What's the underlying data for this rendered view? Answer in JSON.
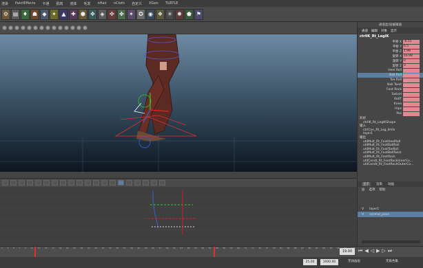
{
  "menus": [
    "渲染",
    "PaintEffects",
    "卡通",
    "肌肉",
    "流体",
    "毛发",
    "nHair",
    "nCloth",
    "自定义",
    "XGen",
    "TURTLE"
  ],
  "channel_box": {
    "header_tabs": [
      "通道",
      "编辑",
      "对象",
      "显示"
    ],
    "panel_title": "通道盒/层编辑器",
    "node_name": "ctrlIK_Rt_LegIK",
    "attributes": [
      {
        "label": "平移 X",
        "value": "-6.55"
      },
      {
        "label": "平移 Y",
        "value": "6.5"
      },
      {
        "label": "平移 Z",
        "value": "1.98"
      },
      {
        "label": "旋转 X",
        "value": "16.98"
      },
      {
        "label": "旋转 Y",
        "value": "0"
      },
      {
        "label": "旋转 Z",
        "value": "0"
      },
      {
        "label": "Heel Roll",
        "value": ""
      },
      {
        "label": "Ball Roll",
        "value": ""
      },
      {
        "label": "Toe Roll",
        "value": ""
      },
      {
        "label": "Ball Twist",
        "value": ""
      },
      {
        "label": "Foot Rock",
        "value": ""
      },
      {
        "label": "Swivel",
        "value": ""
      },
      {
        "label": "RollT",
        "value": ""
      },
      {
        "label": "Knee",
        "value": ""
      },
      {
        "label": "Hips",
        "value": ""
      },
      {
        "label": "Pos",
        "value": ""
      }
    ],
    "section_shape": "形状",
    "shape_name": "ctrlIK_Rt_LegIKShape",
    "section_input": "输入",
    "inputs": [
      "ctrlCon_Rt_Leg_IkVis",
      "layer1"
    ],
    "section_output": "输出",
    "outputs": [
      "utilMult_Rt_FootHeelRoll",
      "utilMult_Rt_FootBallRoll",
      "utilMult_Rt_FootToeRoll",
      "utilMult_Rt_FootBallTwist",
      "utilMult_Rt_FootRock",
      "utilCondt_Rt_FootRockInnerCo...",
      "utilCondt_Rt_FootRockOuterCo..."
    ]
  },
  "layer_panel": {
    "tabs": [
      "显示",
      "渲染",
      "动画"
    ],
    "menu": [
      "层",
      "选项",
      "帮助"
    ],
    "layers": [
      {
        "vis": "V",
        "name": "layer1",
        "selected": false
      },
      {
        "vis": "V",
        "name": "normal_pose",
        "selected": true
      }
    ]
  },
  "timeline": {
    "ticks": [
      "1",
      "2",
      "3",
      "4",
      "5",
      "6",
      "7",
      "8",
      "9",
      "10",
      "11",
      "12",
      "13",
      "14",
      "15",
      "16",
      "17",
      "18",
      "19",
      "20",
      "21",
      "22",
      "23",
      "24",
      "25",
      "26",
      "27",
      "28",
      "29",
      "30",
      "31",
      "32",
      "33",
      "34",
      "35",
      "36",
      "37",
      "38",
      "39",
      "40",
      "41",
      "42",
      "43",
      "44",
      "45",
      "46",
      "47",
      "48",
      "49",
      "50",
      "51",
      "52",
      "53",
      "54",
      "55",
      "56",
      "57",
      "58",
      "59",
      "60",
      "61",
      "62",
      "63",
      "64",
      "65",
      "66",
      "67",
      "68",
      "69",
      "70",
      "71",
      "72",
      "73",
      "74",
      "75",
      "76",
      "77",
      "78",
      "79",
      "80",
      "81",
      "82",
      "83",
      "84",
      "85",
      "86",
      "87",
      "88",
      "89",
      "90",
      "91",
      "92",
      "93",
      "94",
      "95",
      "96",
      "97",
      "98",
      "99",
      "100",
      "101",
      "102"
    ],
    "current_frame": "19.00",
    "range_start": "25.00",
    "range_end": "1000.00",
    "anim_layer": "无动画层",
    "char_set": "无角色集"
  },
  "colors": {
    "accent": "#5a7fa3",
    "attr_field": "#e28a92",
    "curve_red": "#d22",
    "curve_green": "#3c3",
    "curve_blue": "#36c"
  }
}
